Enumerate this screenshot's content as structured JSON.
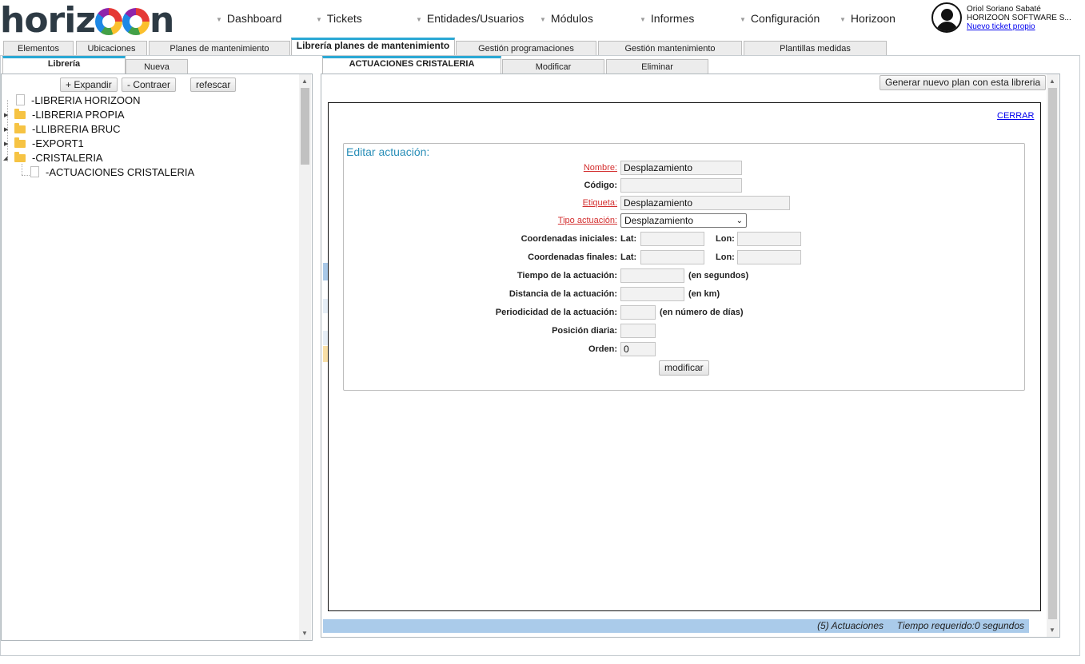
{
  "header": {
    "logo_text": "horiz",
    "logo_text2": "n",
    "menu": [
      "Dashboard",
      "Tickets",
      "Entidades/Usuarios",
      "Módulos",
      "Informes",
      "Configuración",
      "Horizoon"
    ],
    "user_name": "Oriol Soriano Sabaté",
    "company": "HORIZOON SOFTWARE S...",
    "ticket_link": "Nuevo ticket propio"
  },
  "main_tabs": [
    "Elementos",
    "Ubicaciones",
    "Planes de mantenimiento",
    "Librería planes de mantenimiento",
    "Gestión programaciones",
    "Gestión mantenimiento",
    "Plantillas medidas"
  ],
  "left": {
    "tabs": [
      "Librería",
      "Nueva"
    ],
    "buttons": {
      "expand": "+ Expandir",
      "collapse": "- Contraer",
      "refresh": "refescar"
    },
    "tree": [
      "-LIBRERIA HORIZOON",
      "-LIBRERIA PROPIA",
      "-LLIBRERIA BRUC",
      "-EXPORT1",
      "-CRISTALERIA",
      "-ACTUACIONES CRISTALERIA"
    ]
  },
  "right": {
    "tabs": [
      "ACTUACIONES CRISTALERIA",
      "Modificar",
      "Eliminar"
    ],
    "generate_button": "Generar nuevo plan con esta libreria",
    "close_link": "CERRAR",
    "status_count": "(5) Actuaciones",
    "status_time": "Tiempo requerido:0 segundos"
  },
  "form": {
    "title": "Editar actuación:",
    "nombre_label": "Nombre:",
    "nombre_value": "Desplazamiento",
    "codigo_label": "Código:",
    "codigo_value": "",
    "etiqueta_label": "Etiqueta:",
    "etiqueta_value": "Desplazamiento",
    "tipo_label": "Tipo actuación:",
    "tipo_value": "Desplazamiento",
    "coord_ini_label": "Coordenadas iniciales:",
    "coord_fin_label": "Coordenadas finales:",
    "lat_label": "Lat:",
    "lon_label": "Lon:",
    "tiempo_label": "Tiempo de la actuación:",
    "tiempo_unit": "(en segundos)",
    "distancia_label": "Distancia de la actuación:",
    "distancia_unit": "(en km)",
    "periodicidad_label": "Periodicidad de la actuación:",
    "periodicidad_unit": "(en número de días)",
    "posicion_label": "Posición diaria:",
    "orden_label": "Orden:",
    "orden_value": "0",
    "submit": "modificar"
  }
}
